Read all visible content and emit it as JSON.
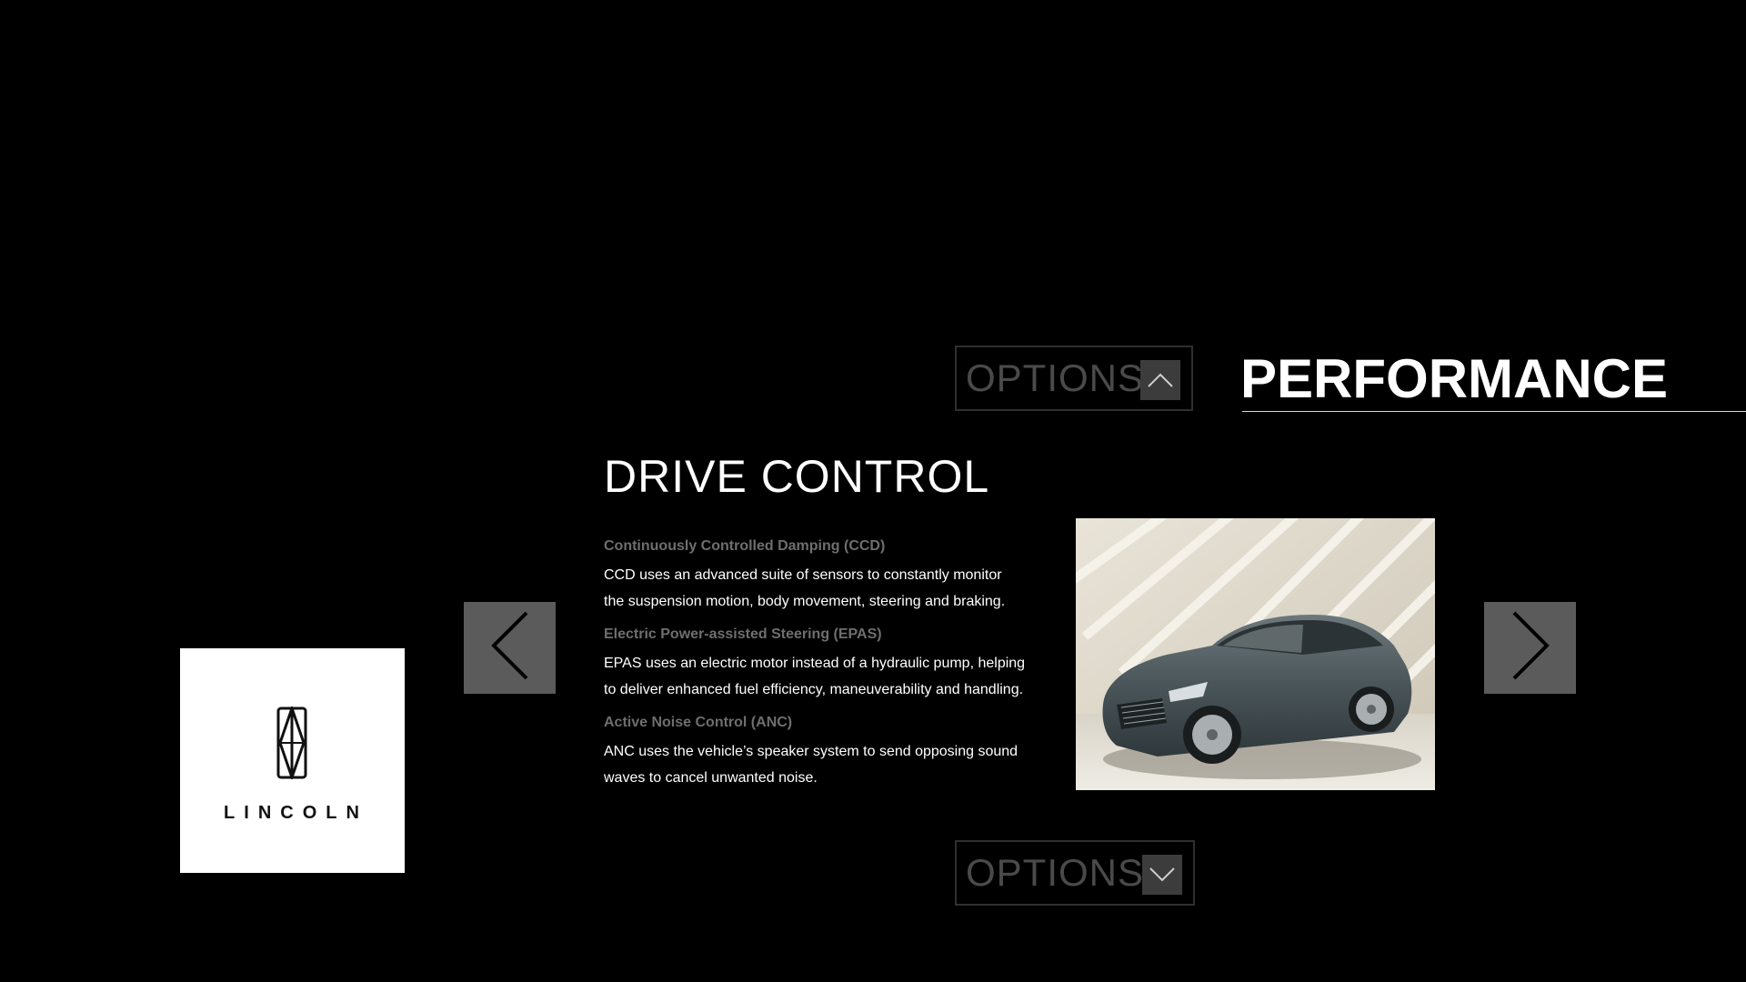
{
  "header": {
    "section_title": "PERFORMANCE",
    "options_label_top": "OPTIONS",
    "options_label_bottom": "OPTIONS"
  },
  "main": {
    "heading": "DRIVE CONTROL",
    "features": [
      {
        "title": "Continuously Controlled Damping (CCD)",
        "body": "CCD uses an advanced suite of sensors to constantly monitor\nthe suspension motion, body movement, steering and braking."
      },
      {
        "title": "Electric Power-assisted Steering (EPAS)",
        "body": "EPAS uses an electric motor instead of a hydraulic pump, helping\nto deliver enhanced fuel efficiency, maneuverability and handling."
      },
      {
        "title": "Active Noise Control (ANC)",
        "body": "ANC uses the vehicle’s speaker system to send opposing sound\nwaves to cancel unwanted noise."
      }
    ]
  },
  "logo": {
    "brand": "LINCOLN"
  },
  "icons": {
    "options_top": "chevron-up-icon",
    "options_bottom": "chevron-down-icon",
    "prev": "chevron-left-icon",
    "next": "chevron-right-icon"
  },
  "colors": {
    "background": "#000000",
    "nav_button": "#5b5b5b",
    "options_text": "#4a4a4a",
    "feature_title": "#6e6e6e"
  }
}
